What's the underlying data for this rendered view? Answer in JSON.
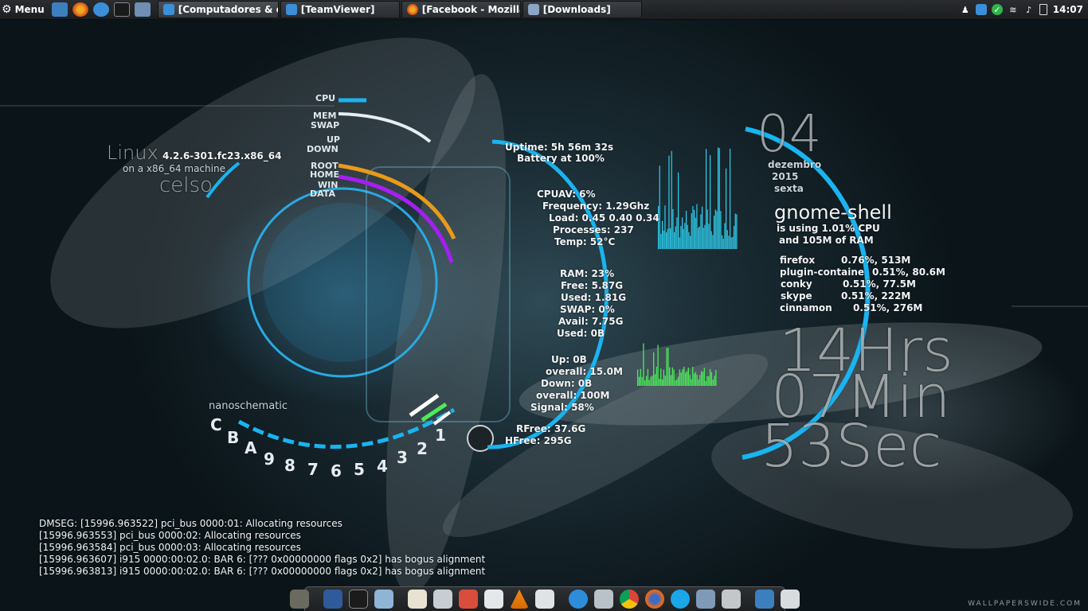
{
  "top_panel": {
    "menu_label": "Menu",
    "tasks": [
      {
        "label": "[Computadores & c..."
      },
      {
        "label": "[TeamViewer]"
      },
      {
        "label": "[Facebook - Mozilla..."
      },
      {
        "label": "[Downloads]"
      }
    ],
    "clock": "14:07"
  },
  "conky": {
    "kernel_title": "Linux",
    "kernel_version": "4.2.6-301.fc23.x86_64",
    "machine": "on a x86_64 machine",
    "hostname": "celso",
    "brand": "nanoschematic",
    "ring_labels": [
      "CPU",
      "MEM",
      "SWAP",
      "UP",
      "DOWN",
      "ROOT",
      "HOME",
      "WIN",
      "DATA"
    ],
    "dial_letters": [
      "C",
      "B",
      "A"
    ],
    "dial_numbers": [
      "9",
      "8",
      "7",
      "6",
      "5",
      "4",
      "3",
      "2",
      "1"
    ],
    "system": [
      "Uptime: 5h 56m 32s",
      "Battery at 100%",
      "CPUAV: 6%",
      "Frequency: 1.29Ghz",
      "Load: 0.45 0.40 0.34",
      "Processes: 237",
      "Temp: 52°C",
      "RAM: 23%",
      "Free: 5.87G",
      "Used: 1.81G",
      "SWAP: 0%",
      "Avail: 7.75G",
      "Used: 0B",
      "Up: 0B",
      "overall: 15.0M",
      "Down: 0B",
      "overall: 100M",
      "Signal: 58%",
      "RFree: 37.6G",
      "HFree: 295G"
    ],
    "date": {
      "day": "04",
      "month": "dezembro",
      "year": "2015",
      "weekday": "sexta"
    },
    "top_process": {
      "name": "gnome-shell",
      "cpu_line": "is using  1.01% CPU",
      "mem_line": "and 105M of RAM"
    },
    "processes": [
      {
        "name": "firefox",
        "usage": "0.76%, 513M"
      },
      {
        "name": "plugin-containe",
        "usage": "0.51%, 80.6M"
      },
      {
        "name": "conky",
        "usage": "0.51%, 77.5M"
      },
      {
        "name": "skype",
        "usage": "0.51%, 222M"
      },
      {
        "name": "cinnamon",
        "usage": "0.51%, 276M"
      }
    ],
    "time_big": {
      "hours": "14Hrs",
      "minutes": "07Min",
      "seconds": "53Sec"
    },
    "dmesg": [
      "DMSEG: [15996.963522] pci_bus 0000:01: Allocating resources",
      "[15996.963553] pci_bus 0000:02: Allocating resources",
      "[15996.963584] pci_bus 0000:03: Allocating resources",
      "[15996.963607] i915 0000:00:02.0: BAR 6: [??? 0x00000000 flags 0x2] has bogus alignment",
      "[15996.963813] i915 0000:00:02.0: BAR 6: [??? 0x00000000 flags 0x2] has bogus alignment"
    ]
  },
  "watermark": "WALLPAPERSWIDE.COM",
  "colors": {
    "accent_cyan": "#1ab4f0",
    "ring_orange": "#e89a1a",
    "ring_purple": "#a51ff0",
    "ring_white": "#e6eef2",
    "graph_cyan": "#2fd3f2",
    "graph_green": "#4bea5a"
  }
}
